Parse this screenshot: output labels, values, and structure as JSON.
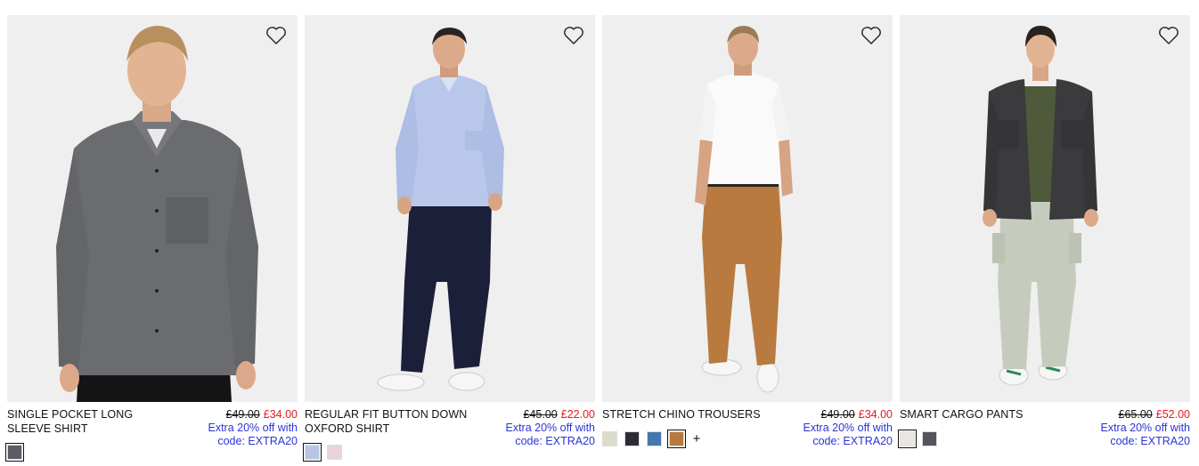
{
  "products": [
    {
      "name": "SINGLE POCKET LONG SLEEVE SHIRT",
      "was_price": "£49.00",
      "sale_price": "£34.00",
      "promo": "Extra 20% off with code: EXTRA20",
      "swatches": [
        "#5a5d66"
      ],
      "selected": 0,
      "more": ""
    },
    {
      "name": "REGULAR FIT BUTTON DOWN OXFORD SHIRT",
      "was_price": "£45.00",
      "sale_price": "£22.00",
      "promo": "Extra 20% off with code: EXTRA20",
      "swatches": [
        "#b7c6e6",
        "#e8d3dd"
      ],
      "selected": 0,
      "more": ""
    },
    {
      "name": "STRETCH CHINO TROUSERS",
      "was_price": "£49.00",
      "sale_price": "£34.00",
      "promo": "Extra 20% off with code: EXTRA20",
      "swatches": [
        "#dcdccc",
        "#2c2c38",
        "#4676b0",
        "#b87a3e"
      ],
      "selected": 3,
      "more": "+"
    },
    {
      "name": "SMART CARGO PANTS",
      "was_price": "£65.00",
      "sale_price": "£52.00",
      "promo": "Extra 20% off with code: EXTRA20",
      "swatches": [
        "#ebe6e2",
        "#55535c"
      ],
      "selected": 0,
      "more": ""
    }
  ],
  "colors": {
    "sale": "#e01a22",
    "promo": "#2b35d6",
    "image_bg": "#efefef"
  },
  "icons": {
    "wishlist": "heart-outline-icon"
  }
}
